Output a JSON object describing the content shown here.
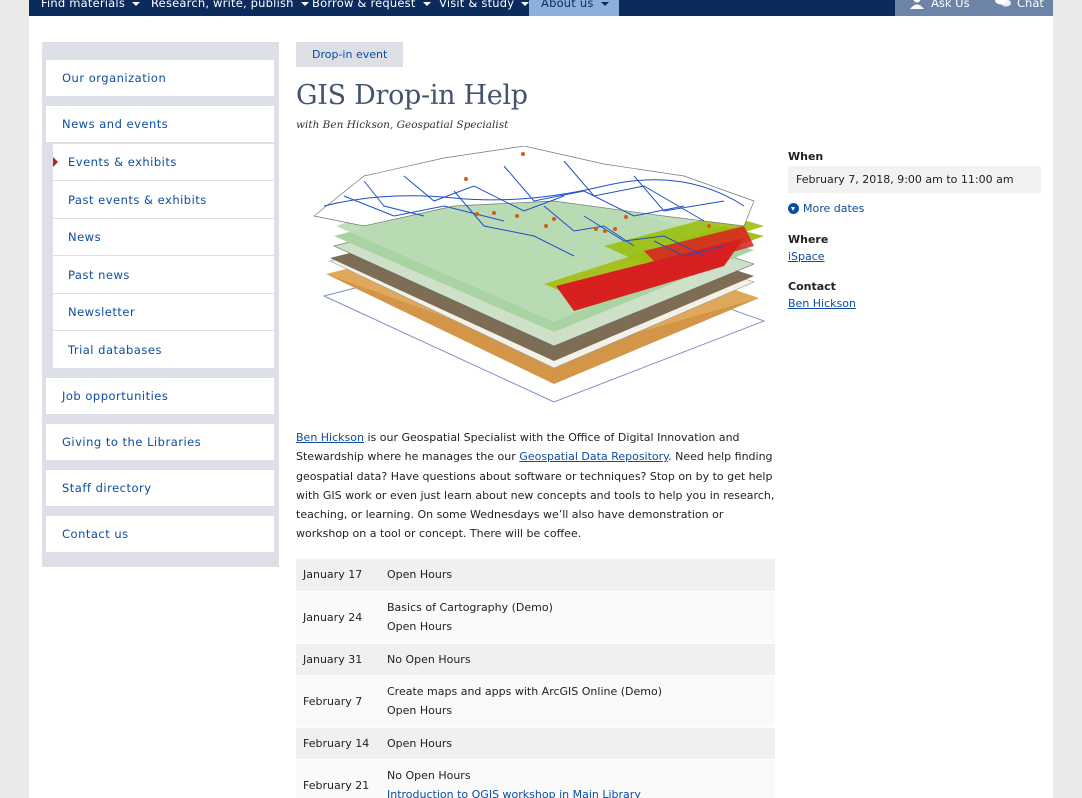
{
  "nav": {
    "items": [
      {
        "label": "Find materials"
      },
      {
        "label": "Research, write, publish"
      },
      {
        "label": "Borrow & request"
      },
      {
        "label": "Visit & study"
      },
      {
        "label": "About us"
      }
    ],
    "ask_us": "Ask Us",
    "chat": "Chat"
  },
  "sidebar": {
    "items": [
      {
        "label": "Our organization"
      },
      {
        "label": "News and events"
      },
      {
        "label": "Events & exhibits"
      },
      {
        "label": "Past events & exhibits"
      },
      {
        "label": "News"
      },
      {
        "label": "Past news"
      },
      {
        "label": "Newsletter"
      },
      {
        "label": "Trial databases"
      },
      {
        "label": "Job opportunities"
      },
      {
        "label": "Giving to the Libraries"
      },
      {
        "label": "Staff directory"
      },
      {
        "label": "Contact us"
      }
    ]
  },
  "event": {
    "tag": "Drop-in event",
    "title": "GIS Drop-in Help",
    "subtitle": "with Ben Hickson, Geospatial Specialist",
    "description": {
      "link1": "Ben Hickson",
      "text1": " is our Geospatial Specialist with the Office of Digital Innovation and Stewardship where he manages the our ",
      "link2": "Geospatial Data Repository",
      "text2": ". Need help finding geospatial data? Have questions about software or techniques? Stop on by to get help with GIS work or even just learn about new concepts and tools to help you in research, teaching, or learning. On some Wednesdays we’ll also have demonstration or workshop on a tool or concept. There will be coffee."
    },
    "schedule": [
      {
        "date": "January 17",
        "lines": [
          "Open Hours"
        ]
      },
      {
        "date": "January 24",
        "lines": [
          "Basics of Cartography (Demo)",
          "Open Hours"
        ]
      },
      {
        "date": "January 31",
        "lines": [
          "No Open Hours"
        ]
      },
      {
        "date": "February 7",
        "lines": [
          "Create maps and apps with ArcGIS Online (Demo)",
          "Open Hours"
        ]
      },
      {
        "date": "February 14",
        "lines": [
          "Open Hours"
        ]
      },
      {
        "date": "February 21",
        "lines": [
          "No Open Hours",
          "Introduction to QGIS workshop in Main Library"
        ]
      }
    ]
  },
  "info": {
    "when_label": "When",
    "when_value": "February 7, 2018, 9:00 am to 11:00 am",
    "more_dates": "More dates",
    "where_label": "Where",
    "where_value": "iSpace",
    "contact_label": "Contact",
    "contact_value": "Ben Hickson"
  },
  "colors": {
    "nav_bg": "#0a2b5c",
    "nav_active": "#8bb0dc",
    "link": "#0c4da2",
    "title": "#44546e",
    "sidebar_bg": "#dcdfe6"
  }
}
